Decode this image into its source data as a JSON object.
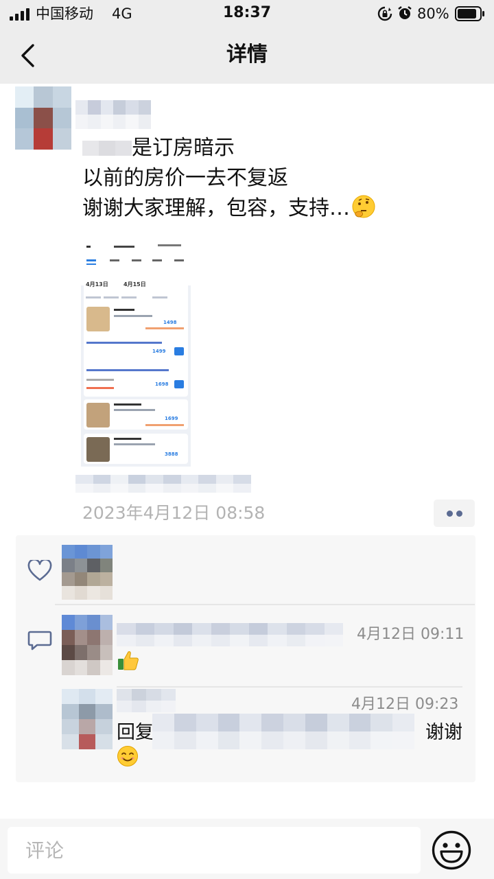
{
  "status_bar": {
    "carrier": "中国移动",
    "network": "4G",
    "time": "18:37",
    "battery_percent": "80%",
    "battery_level": 0.8
  },
  "nav": {
    "title": "详情",
    "back_icon": "chevron-left-icon"
  },
  "post": {
    "lines": [
      "是订房暗示",
      "以前的房价一去不复返",
      "谢谢大家理解，包容，支持…"
    ],
    "time": "2023年4月12日 08:58",
    "screenshot_text": {
      "check_in": "4月13日",
      "check_out": "4月15日",
      "room1_price": "1498",
      "room2_price": "1499",
      "room3_price": "1698",
      "room4_price": "1699",
      "room5_price": "3888",
      "book_label": "订"
    }
  },
  "comments": [
    {
      "time": "4月12日 09:11",
      "emoji": "thumbs-up-emoji"
    },
    {
      "time": "4月12日 09:23",
      "prefix": "回复",
      "suffix": "谢谢",
      "emoji": "smiling-face-emoji"
    }
  ],
  "input": {
    "placeholder": "评论"
  },
  "colors": {
    "header_bg": "#ededed",
    "link_blue": "#5b6b92",
    "timestamp_gray": "#b3b3b3",
    "panel_bg": "#f7f7f7"
  }
}
